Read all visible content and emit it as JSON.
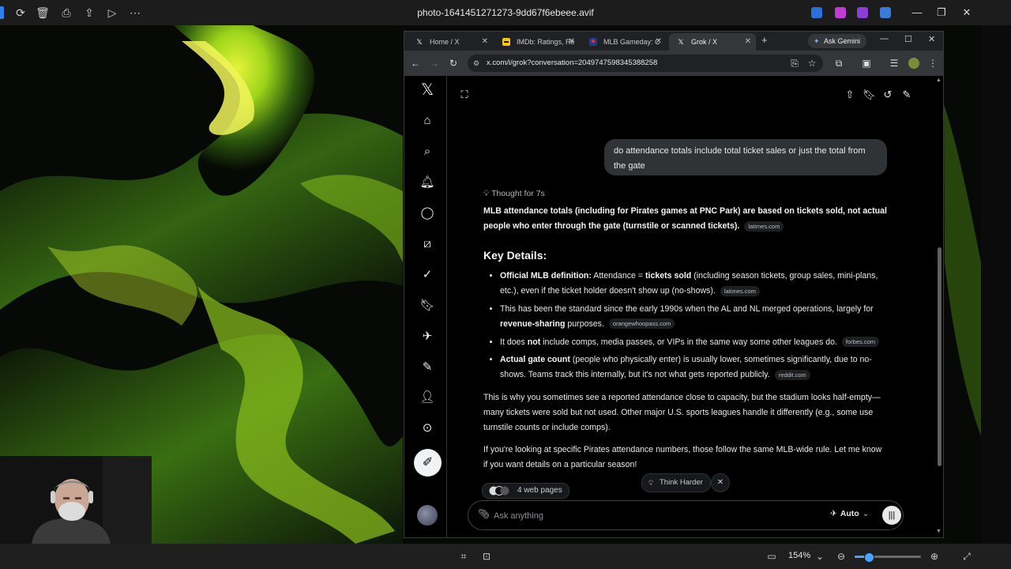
{
  "viewer": {
    "title": "photo-1641451271273-9dd67f6ebeee.avif",
    "zoom_label": "154%",
    "zoom_fraction": 0.22,
    "colors": {
      "wallpaper_green": "#9ed61a",
      "accent": "#4aa3ff"
    }
  },
  "browser": {
    "tabs": [
      {
        "label": "Home / X",
        "icon": "x-logo-icon"
      },
      {
        "label": "IMDb: Ratings, Re",
        "icon": "imdb-icon"
      },
      {
        "label": "MLB Gameday: C",
        "icon": "mlb-icon"
      },
      {
        "label": "Grok / X",
        "icon": "x-logo-icon",
        "active": true
      }
    ],
    "ask_gemini": "Ask Gemini",
    "url": "x.com/i/grok?conversation=2049747598345388258"
  },
  "grok": {
    "user_message": "do attendance totals include total ticket sales or just the total from the gate",
    "thought": "Thought for 7s",
    "intro_bold": "MLB attendance totals (including for Pirates games at PNC Park) are based on tickets sold, not actual people who enter through the gate (turnstile or scanned tickets).",
    "intro_cite": "latimes.com",
    "key_details_heading": "Key Details:",
    "bullets": [
      {
        "lead": "Official MLB definition:",
        "mid": " Attendance = ",
        "strong": "tickets sold",
        "rest": " (including season tickets, group sales, mini-plans, etc.), even if the ticket holder doesn't show up (no-shows).",
        "cite": "latimes.com"
      },
      {
        "pre": "This has been the standard since the early 1990s when the AL and NL merged operations, largely for ",
        "strong": "revenue-sharing",
        "rest": " purposes.",
        "cite": "orangewhoopass.com"
      },
      {
        "pre": "It does ",
        "strong": "not",
        "rest": " include comps, media passes, or VIPs in the same way some other leagues do.",
        "cite": "forbes.com"
      },
      {
        "lead": "Actual gate count",
        "rest": " (people who physically enter) is usually lower, sometimes significantly, due to no-shows. Teams track this internally, but it's not what gets reported publicly.",
        "cite": "reddit.com"
      }
    ],
    "para1": "This is why you sometimes see a reported attendance close to capacity, but the stadium looks half-empty—many tickets were sold but not used. Other major U.S. sports leagues handle it differently (e.g., some use turnstile counts or include comps).",
    "para2": "If you're looking at specific Pirates attendance numbers, those follow the same MLB-wide rule. Let me know if you want details on a particular season!",
    "sources": "4 web pages",
    "think_harder": "Think Harder",
    "composer_placeholder": "Ask anything",
    "mode": "Auto"
  }
}
